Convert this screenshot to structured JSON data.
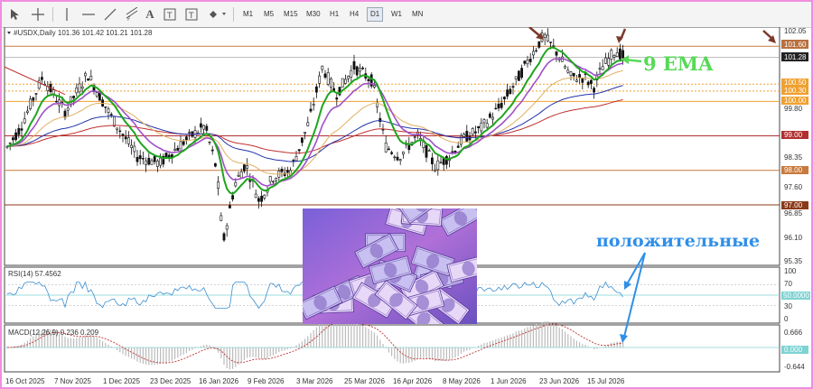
{
  "toolbar": {
    "tools": [
      "cursor-icon",
      "crosshair-icon",
      "vertical-line-icon",
      "horizontal-line-icon",
      "trendline-icon",
      "text-icon",
      "label-icon",
      "shapes-icon"
    ],
    "timeframes": [
      "M1",
      "M5",
      "M15",
      "M30",
      "H1",
      "H4",
      "D1",
      "W1",
      "MN"
    ],
    "active_timeframe": "D1"
  },
  "header": {
    "symbol_info": "#USDX,Daily  101.36 101.42 101.21 101.28"
  },
  "price_axis": {
    "labels": [
      "102.05",
      "101.60",
      "101.28",
      "100.50",
      "100.30",
      "100.00",
      "99.80",
      "99.00",
      "98.35",
      "98.00",
      "97.60",
      "97.00",
      "96.85",
      "96.10",
      "95.35"
    ]
  },
  "level_lines": [
    {
      "label": "101.60",
      "color": "#c87a3c"
    },
    {
      "label": "100.50",
      "color": "#f0a030"
    },
    {
      "label": "100.30",
      "color": "#f0a030"
    },
    {
      "label": "100.00",
      "color": "#f0a030"
    },
    {
      "label": "99.00",
      "color": "#b03030"
    },
    {
      "label": "98.00",
      "color": "#c87a3c"
    },
    {
      "label": "97.00",
      "color": "#8b3a1a"
    }
  ],
  "current_price": "101.28",
  "rsi": {
    "title": "RSI(14) 57.4562",
    "scale": [
      "100",
      "70",
      "50",
      "30",
      "0"
    ],
    "level_label": "50.0000"
  },
  "macd": {
    "title": "MACD(12,26,9) 0.236 0.209",
    "scale": [
      "0.666",
      "0.000",
      "-0.644"
    ],
    "level_label": "0.000"
  },
  "date_axis": [
    "16 Oct 2025",
    "7 Nov 2025",
    "1 Dec 2025",
    "23 Dec 2025",
    "16 Jan 2026",
    "9 Feb 2026",
    "3 Mar 2026",
    "25 Mar 2026",
    "16 Apr 2026",
    "8 May 2026",
    "1 Jun 2026",
    "23 Jun 2026",
    "15 Jul 2026"
  ],
  "annotations": {
    "ema_label": "9 EMA",
    "positive_label": "положительные"
  },
  "colors": {
    "bull": "#1a1a1a",
    "ema9": "#1ea51e",
    "ema_fast2": "#a050c8",
    "ema50": "#e0b060",
    "ema100": "#2233aa",
    "ema200": "#c03030",
    "rsi_line": "#3a8fd0",
    "macd_signal": "#c03030",
    "arrow_brown": "#7a3a2a",
    "arrow_blue": "#2f8fe8",
    "arrow_green": "#58d958"
  }
}
